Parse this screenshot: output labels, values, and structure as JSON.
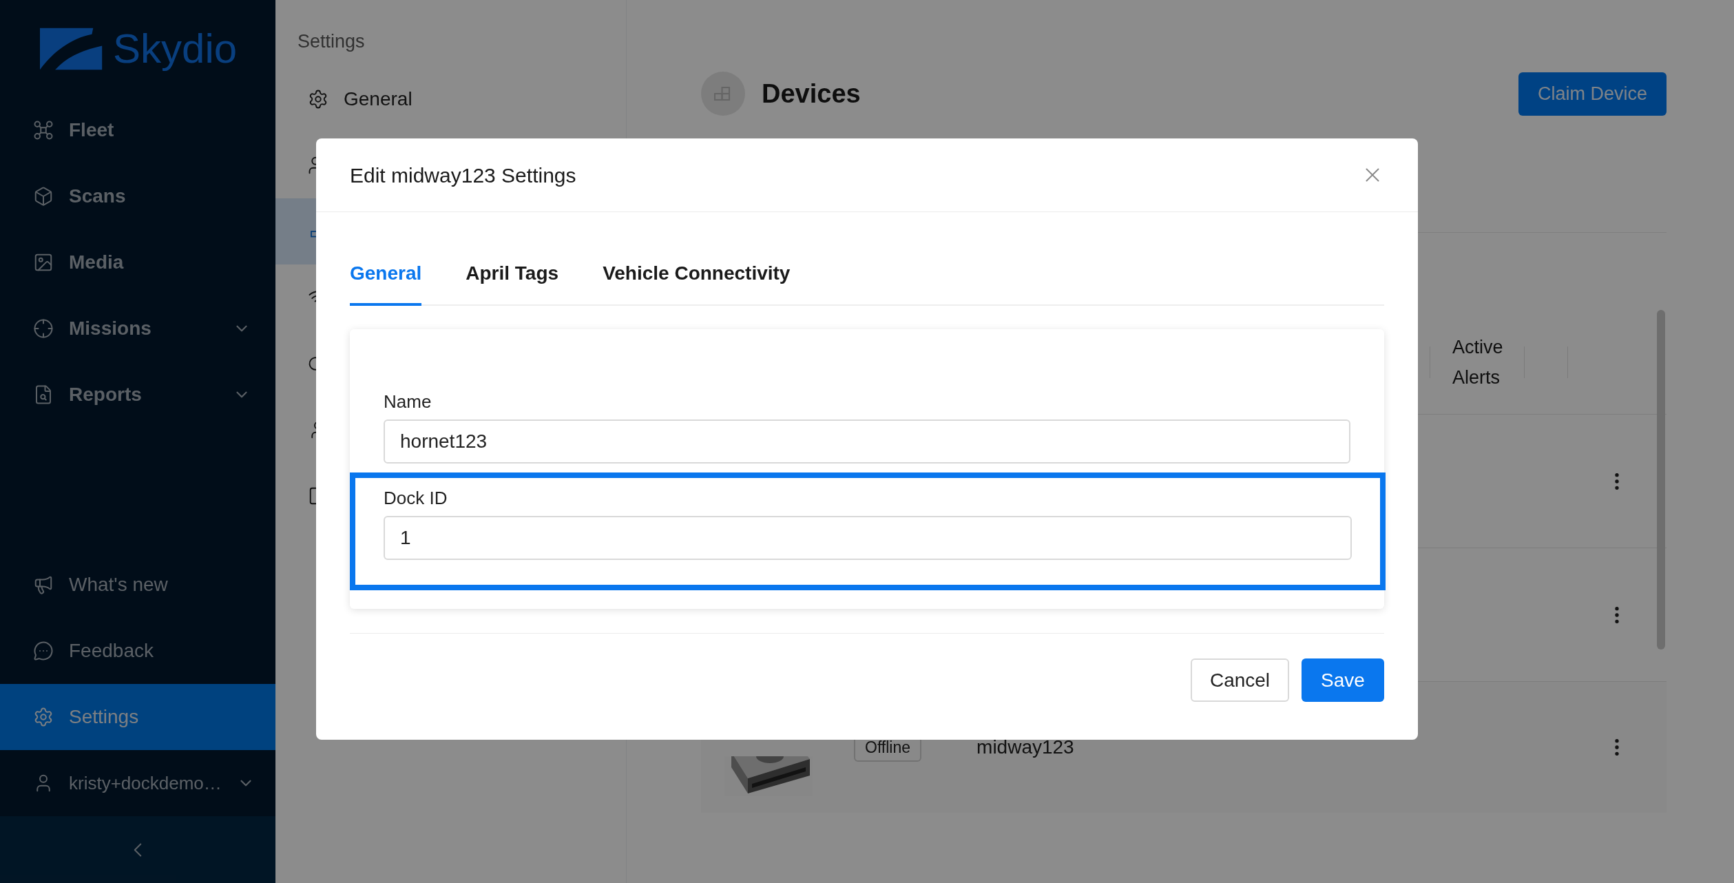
{
  "sidebar": {
    "logo_text": "Skydio",
    "items": [
      {
        "label": "Fleet",
        "kind": "fleet",
        "expandable": false
      },
      {
        "label": "Scans",
        "kind": "scans",
        "expandable": false
      },
      {
        "label": "Media",
        "kind": "media",
        "expandable": false
      },
      {
        "label": "Missions",
        "kind": "missions",
        "expandable": true
      },
      {
        "label": "Reports",
        "kind": "reports",
        "expandable": true
      }
    ],
    "bottom_items": [
      {
        "label": "What's new",
        "kind": "news",
        "selected": false
      },
      {
        "label": "Feedback",
        "kind": "feedback",
        "selected": false
      },
      {
        "label": "Settings",
        "kind": "settings",
        "selected": true
      }
    ],
    "user": {
      "label": "kristy+dockdemo…"
    }
  },
  "settings_nav": {
    "title": "Settings",
    "items": [
      {
        "label": "General",
        "kind": "gear",
        "selected": false
      },
      {
        "kind": "users",
        "selected": false
      },
      {
        "kind": "devices",
        "selected": true
      },
      {
        "kind": "wifi",
        "selected": false
      },
      {
        "kind": "cloud",
        "selected": false
      },
      {
        "kind": "person",
        "selected": false
      },
      {
        "kind": "square",
        "selected": false
      }
    ]
  },
  "page": {
    "title": "Devices",
    "claim_button": "Claim Device",
    "table": {
      "header": "Active Alerts",
      "rows": [
        {
          "kind": "covered"
        },
        {
          "kind": "covered"
        },
        {
          "kind": "device",
          "status": "Offline",
          "name": "midway123"
        }
      ]
    }
  },
  "modal": {
    "title": "Edit midway123 Settings",
    "tabs": [
      {
        "label": "General",
        "selected": true
      },
      {
        "label": "April Tags",
        "selected": false
      },
      {
        "label": "Vehicle Connectivity",
        "selected": false
      }
    ],
    "fields": [
      {
        "label": "Name",
        "value": "hornet123",
        "highlighted": false
      },
      {
        "label": "Dock ID",
        "value": "1",
        "highlighted": true
      }
    ],
    "buttons": [
      {
        "label": "Cancel",
        "kind": "secondary"
      },
      {
        "label": "Save",
        "kind": "primary"
      }
    ]
  }
}
